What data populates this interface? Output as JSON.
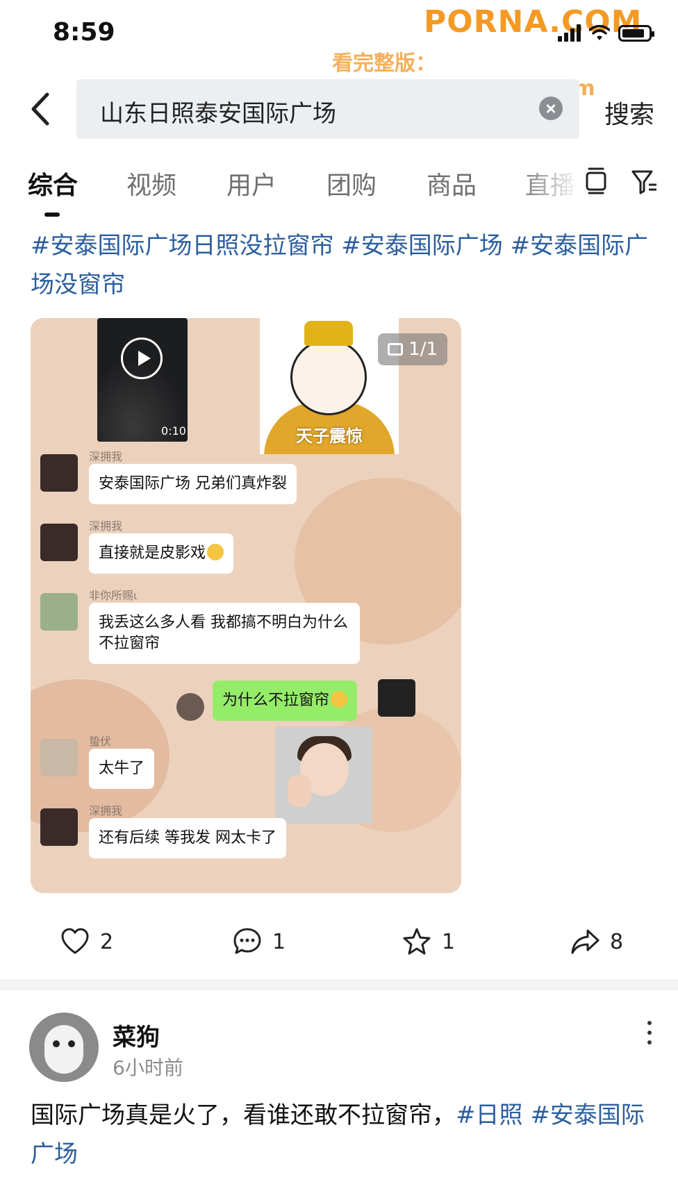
{
  "status_bar": {
    "time": "8:59"
  },
  "watermark": {
    "brand": "PORNA.COM",
    "url_line": "看完整版：https://91wang75.com"
  },
  "search": {
    "query": "山东日照泰安国际广场",
    "button_label": "搜索"
  },
  "tabs": [
    {
      "label": "综合",
      "active": true
    },
    {
      "label": "视频",
      "active": false
    },
    {
      "label": "用户",
      "active": false
    },
    {
      "label": "团购",
      "active": false
    },
    {
      "label": "商品",
      "active": false
    },
    {
      "label": "直播",
      "active": false
    }
  ],
  "post1": {
    "hashtags": "#安泰国际广场日照没拉窗帘 #安泰国际广场 #安泰国际广场没窗帘",
    "image_counter": "1/1",
    "screenshot": {
      "video_duration": "0:10",
      "meme_caption": "天子震惊",
      "messages": [
        {
          "name": "深拥我",
          "text": "安泰国际广场 兄弟们真炸裂"
        },
        {
          "name": "深拥我",
          "text": "直接就是皮影戏"
        },
        {
          "name": "非你所赐ι",
          "text": "我丢这么多人看 我都搞不明白为什么不拉窗帘"
        },
        {
          "name": "",
          "text": "为什么不拉窗帘"
        },
        {
          "name": "蛰伏",
          "text": "太牛了"
        },
        {
          "name": "深拥我",
          "text": "还有后续 等我发 网太卡了"
        }
      ]
    },
    "actions": {
      "likes": "2",
      "comments": "1",
      "favorites": "1",
      "shares": "8"
    }
  },
  "post2": {
    "author": "菜狗",
    "time": "6小时前",
    "text_plain": "国际广场真是火了，看谁还敢不拉窗帘，",
    "tag1": "#日照",
    "tag2": "#安泰国际广场"
  }
}
